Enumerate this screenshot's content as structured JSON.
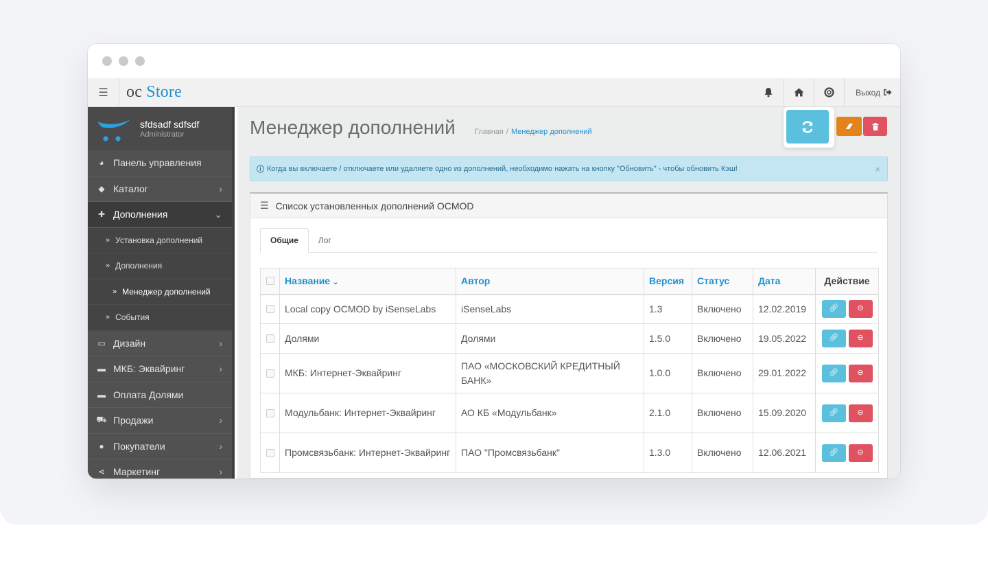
{
  "app": {
    "logo_oc": "oc",
    "logo_store": "Store",
    "logout": "Выход"
  },
  "sidebar": {
    "user_name": "sfdsadf sdfsdf",
    "user_role": "Administrator",
    "items": [
      {
        "label": "Панель управления",
        "icon": "dashboard-icon"
      },
      {
        "label": "Каталог",
        "icon": "tags-icon"
      },
      {
        "label": "Дополнения",
        "icon": "puzzle-icon"
      },
      {
        "label": "Дизайн",
        "icon": "monitor-icon"
      },
      {
        "label": "МКБ: Эквайринг",
        "icon": "card-icon"
      },
      {
        "label": "Оплата Долями",
        "icon": "card-icon"
      },
      {
        "label": "Продажи",
        "icon": "cart-icon"
      },
      {
        "label": "Покупатели",
        "icon": "user-icon"
      },
      {
        "label": "Маркетинг",
        "icon": "share-icon"
      }
    ],
    "subitems": [
      {
        "label": "Установка дополнений"
      },
      {
        "label": "Дополнения"
      },
      {
        "label": "Менеджер дополнений"
      },
      {
        "label": "События"
      }
    ]
  },
  "page": {
    "title": "Менеджер дополнений",
    "breadcrumb_home": "Главная",
    "breadcrumb_current": "Менеджер дополнений",
    "alert": "Когда вы включаете / отключаете или удаляете одно из дополнений, необходимо нажать на кнопку \"Обновить\" - чтобы обновить Кэш!",
    "alert_close": "×",
    "panel_title": "Список установленных дополнений OCMOD",
    "tabs": [
      "Общие",
      "Лог"
    ]
  },
  "table": {
    "headers": {
      "name": "Название",
      "author": "Автор",
      "version": "Версия",
      "status": "Статус",
      "date": "Дата",
      "action": "Действие"
    },
    "rows": [
      {
        "name": "Local copy OCMOD by iSenseLabs",
        "author": "iSenseLabs",
        "version": "1.3",
        "status": "Включено",
        "date": "12.02.2019"
      },
      {
        "name": "Долями",
        "author": "Долями",
        "version": "1.5.0",
        "status": "Включено",
        "date": "19.05.2022"
      },
      {
        "name": "МКБ: Интернет-Эквайринг",
        "author": "ПАО «МОСКОВСКИЙ КРЕДИТНЫЙ БАНК»",
        "version": "1.0.0",
        "status": "Включено",
        "date": "29.01.2022"
      },
      {
        "name": "Модульбанк: Интернет-Эквайринг",
        "author": "АО КБ «Модульбанк»",
        "version": "2.1.0",
        "status": "Включено",
        "date": "15.09.2020"
      },
      {
        "name": "Промсвязьбанк: Интернет-Эквайринг",
        "author": "ПАО \"Промсвязьбанк\"",
        "version": "1.3.0",
        "status": "Включено",
        "date": "12.06.2021"
      }
    ]
  },
  "colors": {
    "accent": "#1e91cf",
    "info": "#5bc0de",
    "danger": "#e05260",
    "warning": "#e3831c"
  }
}
